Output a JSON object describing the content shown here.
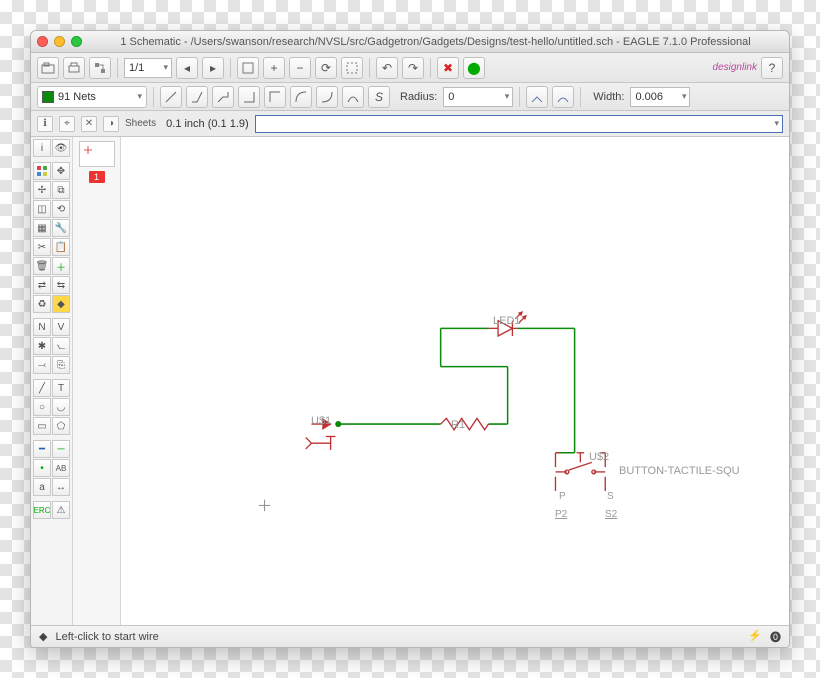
{
  "window": {
    "title": "1 Schematic - /Users/swanson/research/NVSL/src/Gadgetron/Gadgets/Designs/test-hello/untitled.sch - EAGLE 7.1.0 Professional"
  },
  "toolbar": {
    "layer_label": "91 Nets",
    "page_label": "1/1",
    "radius_label": "Radius:",
    "radius_value": "0",
    "width_label": "Width:",
    "width_value": "0.006",
    "design_link": "designlink"
  },
  "infobar": {
    "sheets_label": "Sheets",
    "coord": "0.1 inch (0.1 1.9)"
  },
  "sheets": {
    "current": "1"
  },
  "schematic": {
    "us1": "U$1",
    "r1": "R1",
    "led1": "LED1",
    "us2": "U$2",
    "button": "BUTTON-TACTILE-SQU",
    "p": "P",
    "s": "S",
    "p2": "P2",
    "s2": "S2"
  },
  "statusbar": {
    "hint": "Left-click to start wire",
    "bolt": "⚡",
    "stop": "⓿"
  }
}
